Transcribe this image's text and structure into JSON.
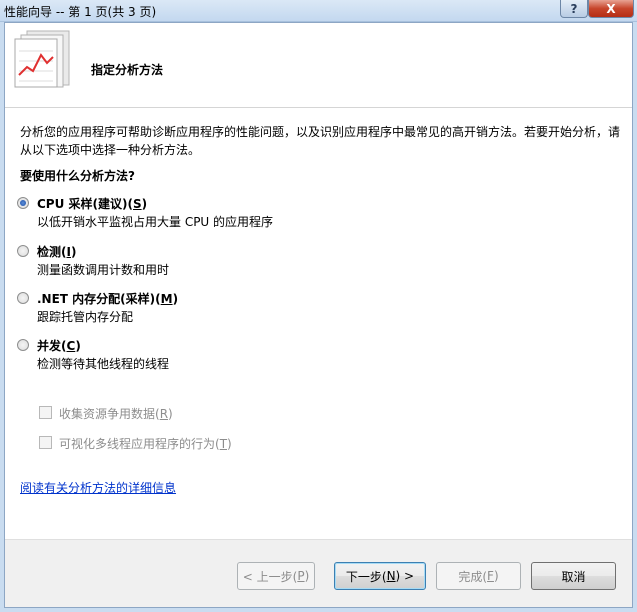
{
  "window": {
    "title": "性能向导 -- 第 1 页(共 3 页)",
    "help_glyph": "?",
    "close_glyph": "X"
  },
  "header": {
    "title": "指定分析方法"
  },
  "intro": "分析您的应用程序可帮助诊断应用程序的性能问题，以及识别应用程序中最常见的高开销方法。若要开始分析，请从以下选项中选择一种分析方法。",
  "question": "要使用什么分析方法?",
  "options": [
    {
      "label": "CPU 采样(建议)(",
      "key": "S",
      "tail": ")",
      "desc": "以低开销水平监视占用大量 CPU 的应用程序",
      "checked": true
    },
    {
      "label": "检测(",
      "key": "I",
      "tail": ")",
      "desc": "测量函数调用计数和用时",
      "checked": false
    },
    {
      "label": ".NET 内存分配(采样)(",
      "key": "M",
      "tail": ")",
      "desc": "跟踪托管内存分配",
      "checked": false
    },
    {
      "label": "并发(",
      "key": "C",
      "tail": ")",
      "desc": "检测等待其他线程的线程",
      "checked": false
    }
  ],
  "concurrency_options": [
    {
      "label": "收集资源争用数据(",
      "key": "R",
      "tail": ")",
      "checked": false,
      "enabled": false
    },
    {
      "label": "可视化多线程应用程序的行为(",
      "key": "T",
      "tail": ")",
      "checked": false,
      "enabled": false
    }
  ],
  "link": "阅读有关分析方法的详细信息",
  "buttons": {
    "back": {
      "pre": "< 上一步(",
      "key": "P",
      "post": ")"
    },
    "next": {
      "pre": "下一步(",
      "key": "N",
      "post": ") >"
    },
    "finish": {
      "pre": "完成(",
      "key": "F",
      "post": ")"
    },
    "cancel": "取消"
  },
  "colors": {
    "link": "#0033cc",
    "close_button": "#c7452b",
    "chart_line": "#e03030"
  }
}
